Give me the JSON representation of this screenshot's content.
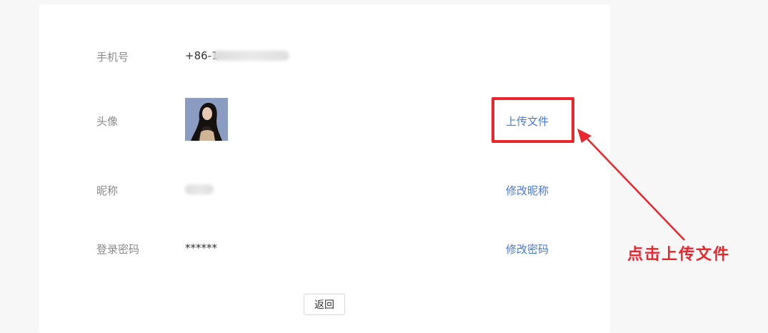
{
  "profile": {
    "phone_label": "手机号",
    "phone_value": "+86-1",
    "avatar_label": "头像",
    "upload_label": "上传文件",
    "nickname_label": "昵称",
    "edit_nickname_label": "修改昵称",
    "password_label": "登录密码",
    "password_value": "******",
    "edit_password_label": "修改密码",
    "back_label": "返回"
  },
  "annotation": {
    "callout_text": "点击上传文件",
    "color": "#e8262b"
  },
  "colors": {
    "link": "#4a78d6",
    "background": "#f7f7f8"
  }
}
